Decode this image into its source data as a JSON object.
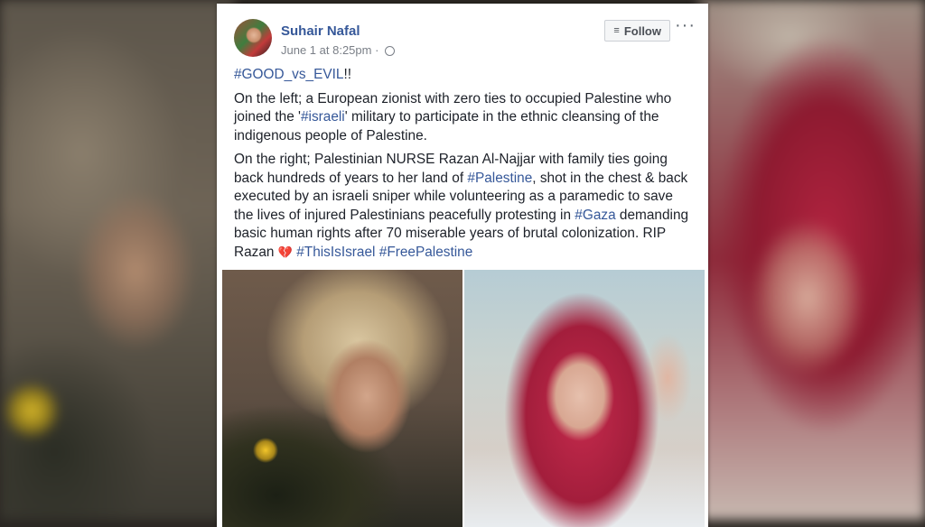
{
  "post": {
    "author": "Suhair Nafal",
    "timestamp": "June 1 at 8:25pm",
    "meta_separator": " · ",
    "follow_label": "Follow",
    "more_icon": "···",
    "heading_tag": "#GOOD_vs_EVIL",
    "heading_suffix": "!!",
    "para1": {
      "part1": "On the left; a European zionist with zero ties to occupied Palestine who joined the '",
      "tag": "#israeli",
      "part2": "' military to participate in the ethnic cleansing of the indigenous people of Palestine."
    },
    "para2": {
      "part1": "On the right; Palestinian NURSE Razan Al-Najjar with family ties going back hundreds of years to her land of ",
      "tag1": "#Palestine",
      "part2": ", shot in the chest & back executed by an israeli sniper while volunteering as a paramedic to save the lives of injured Palestinians peacefully protesting in ",
      "tag2": "#Gaza",
      "part3": " demanding basic human rights after 70 miserable years of brutal colonization. RIP Razan ",
      "heart": "💔",
      "tag3": "#ThisIsIsrael",
      "tag4": "#FreePalestine"
    }
  },
  "icons": {
    "rss": "rss-icon",
    "globe": "globe-icon",
    "more": "more-icon",
    "heart": "broken-heart-icon"
  },
  "colors": {
    "link": "#365899",
    "text": "#1d2129",
    "meta": "#7a7f87"
  }
}
